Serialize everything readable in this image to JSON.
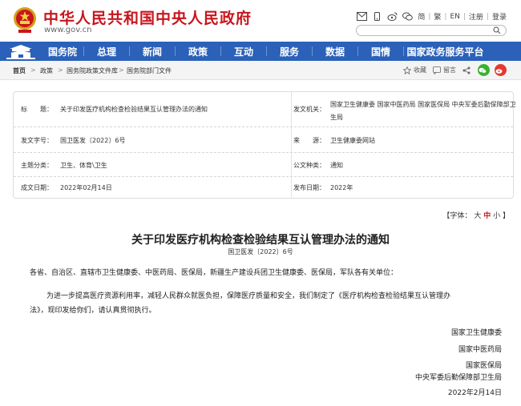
{
  "header": {
    "site_title": "中华人民共和国中央人民政府",
    "site_url": "www.gov.cn",
    "lang_simplified": "简",
    "lang_traditional": "繁",
    "lang_english": "EN",
    "register": "注册",
    "login": "登录"
  },
  "nav": {
    "items": [
      "国务院",
      "总理",
      "新闻",
      "政策",
      "互动",
      "服务",
      "数据",
      "国情",
      "国家政务服务平台"
    ]
  },
  "breadcrumb": {
    "items": [
      "首页",
      "政策",
      "国务院政策文件库",
      "国务院部门文件"
    ]
  },
  "share": {
    "favorite": "收藏",
    "comment": "留言"
  },
  "meta": {
    "title_label": "标　　题：",
    "title_value": "关于印发医疗机构检查检验结果互认管理办法的通知",
    "issuer_label": "发文机关：",
    "issuer_value": "国家卫生健康委  国家中医药局  国家医保局  中央军委后勤保障部卫生局",
    "docno_label": "发文字号：",
    "docno_value": "国卫医发〔2022〕6号",
    "source_label": "来　　源：",
    "source_value": "卫生健康委网站",
    "topic_label": "主题分类：",
    "topic_value": "卫生、体育\\卫生",
    "type_label": "公文种类：",
    "type_value": "通知",
    "written_label": "成文日期：",
    "written_value": "2022年02月14日",
    "published_label": "发布日期：",
    "published_value": "2022年"
  },
  "font_size": {
    "open": "【字体：",
    "large": "大",
    "medium": "中",
    "small": "小",
    "close": "】"
  },
  "article": {
    "title": "关于印发医疗机构检查检验结果互认管理办法的通知",
    "doc_number": "国卫医发〔2022〕6号",
    "salutation": "各省、自治区、直辖市卫生健康委、中医药局、医保局，新疆生产建设兵团卫生健康委、医保局，军队各有关单位：",
    "body_line1": "为进一步提高医疗资源利用率，减轻人民群众就医负担，保障医疗质量和安全，我们制定了《医疗机构检查检验结果互认管理办",
    "body_line2": "法》，现印发给你们，请认真贯彻执行。",
    "signatures": [
      "国家卫生健康委",
      "国家中医药局",
      "国家医保局",
      "中央军委后勤保障部卫生局",
      "2022年2月14日"
    ]
  },
  "colors": {
    "brand_red": "#c8161e",
    "nav_blue": "#2b61b8"
  }
}
